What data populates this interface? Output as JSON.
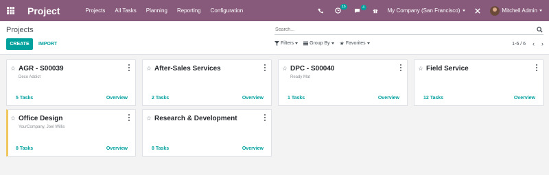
{
  "navbar": {
    "app_name": "Project",
    "menu": [
      "Projects",
      "All Tasks",
      "Planning",
      "Reporting",
      "Configuration"
    ],
    "activity_count": "16",
    "message_count": "4",
    "company": "My Company (San Francisco)",
    "user": "Mitchell Admin",
    "bg_color": "#875a7b"
  },
  "control": {
    "breadcrumb": "Projects",
    "create_label": "CREATE",
    "import_label": "IMPORT",
    "search_placeholder": "Search...",
    "filters_label": "Filters",
    "groupby_label": "Group By",
    "favorites_label": "Favorites",
    "pager": "1-6 / 6"
  },
  "cards": [
    {
      "title": "AGR - S00039",
      "subtitle": "Deco Addict",
      "tasks": "5 Tasks",
      "overview": "Overview"
    },
    {
      "title": "After-Sales Services",
      "subtitle": "",
      "tasks": "2 Tasks",
      "overview": "Overview"
    },
    {
      "title": "DPC - S00040",
      "subtitle": "Ready Mat",
      "tasks": "1 Tasks",
      "overview": "Overview"
    },
    {
      "title": "Field Service",
      "subtitle": "",
      "tasks": "12 Tasks",
      "overview": "Overview"
    },
    {
      "title": "Office Design",
      "subtitle": "YourCompany, Joel Willis",
      "tasks": "8 Tasks",
      "overview": "Overview"
    },
    {
      "title": "Research & Development",
      "subtitle": "",
      "tasks": "8 Tasks",
      "overview": "Overview"
    }
  ],
  "colors": {
    "accent": "#00a09d",
    "ribbon": "#f0c75e"
  }
}
